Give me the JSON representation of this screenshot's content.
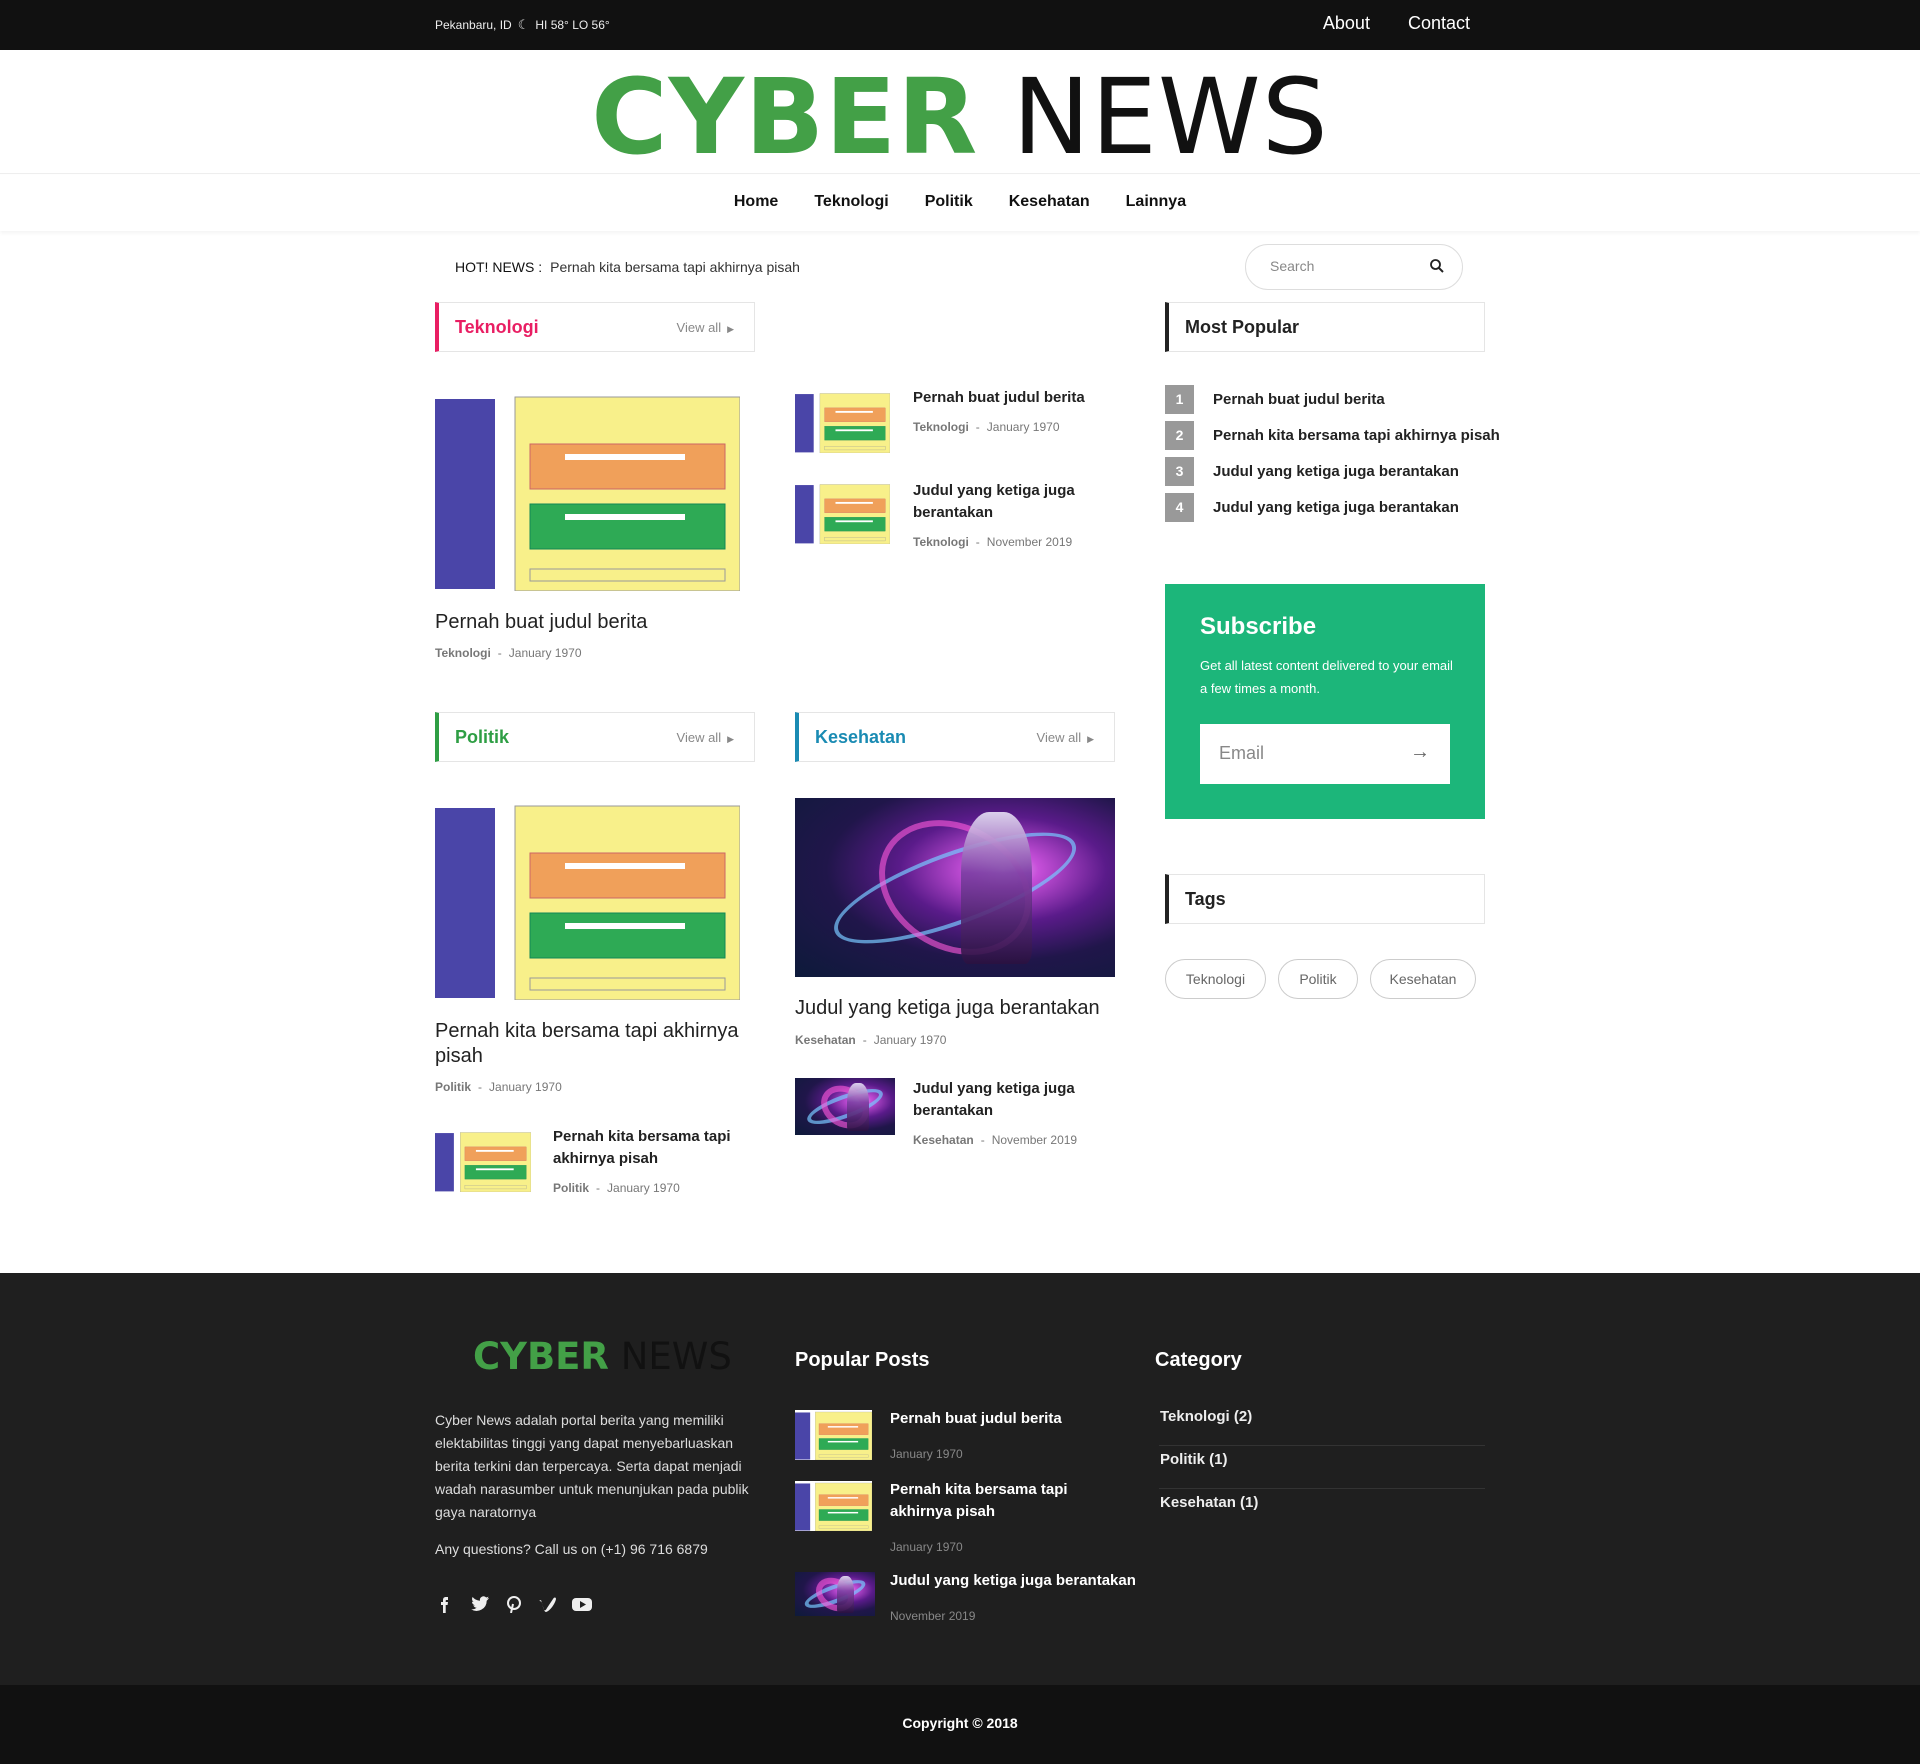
{
  "topbar": {
    "location": "Pekanbaru, ID",
    "weather": "HI 58° LO 56°",
    "links": [
      "About",
      "Contact"
    ]
  },
  "logo": {
    "part1": "CYBER",
    "part2": "NEWS"
  },
  "nav": [
    "Home",
    "Teknologi",
    "Politik",
    "Kesehatan",
    "Lainnya"
  ],
  "hot": {
    "label": "HOT! NEWS :",
    "text": "Pernah kita bersama tapi akhirnya pisah"
  },
  "search": {
    "placeholder": "Search"
  },
  "colors": {
    "teknologi": "#e91e63",
    "politik": "#2e9e44",
    "kesehatan": "#1a8bb3",
    "subscribe": "#1cb67a",
    "logo_green": "#43a047"
  },
  "teknologi": {
    "title": "Teknologi",
    "view_all": "View all",
    "main": {
      "title": "Pernah buat judul berita",
      "cat": "Teknologi",
      "date": "January 1970"
    },
    "side": [
      {
        "title": "Pernah buat judul berita",
        "cat": "Teknologi",
        "date": "January 1970"
      },
      {
        "title": "Judul yang ketiga juga berantakan",
        "cat": "Teknologi",
        "date": "November 2019"
      }
    ]
  },
  "politik": {
    "title": "Politik",
    "view_all": "View all",
    "main": {
      "title": "Pernah kita bersama tapi akhirnya pisah",
      "cat": "Politik",
      "date": "January 1970"
    },
    "side": [
      {
        "title": "Pernah kita bersama tapi akhirnya pisah",
        "cat": "Politik",
        "date": "January 1970"
      }
    ]
  },
  "kesehatan": {
    "title": "Kesehatan",
    "view_all": "View all",
    "main": {
      "title": "Judul yang ketiga juga berantakan",
      "cat": "Kesehatan",
      "date": "January 1970"
    },
    "side": [
      {
        "title": "Judul yang ketiga juga berantakan",
        "cat": "Kesehatan",
        "date": "November 2019"
      }
    ]
  },
  "popular": {
    "title": "Most Popular",
    "items": [
      {
        "num": "1",
        "title": "Pernah buat judul berita"
      },
      {
        "num": "2",
        "title": "Pernah kita bersama tapi akhirnya pisah"
      },
      {
        "num": "3",
        "title": "Judul yang ketiga juga berantakan"
      },
      {
        "num": "4",
        "title": "Judul yang ketiga juga berantakan"
      }
    ]
  },
  "subscribe": {
    "title": "Subscribe",
    "text": "Get all latest content delivered to your email a few times a month.",
    "placeholder": "Email"
  },
  "tags": {
    "title": "Tags",
    "items": [
      "Teknologi",
      "Politik",
      "Kesehatan"
    ]
  },
  "footer": {
    "logo1": "CYBER",
    "logo2": "NEWS",
    "desc": "Cyber News adalah portal berita yang memiliki elektabilitas tinggi yang dapat menyebarluaskan berita terkini dan terpercaya. Serta dapat menjadi wadah narasumber untuk menunjukan pada publik gaya naratornya",
    "call": "Any questions? Call us on (+1) 96 716 6879",
    "popular_title": "Popular Posts",
    "popular": [
      {
        "title": "Pernah buat judul berita",
        "date": "January 1970"
      },
      {
        "title": "Pernah kita bersama tapi akhirnya pisah",
        "date": "January 1970"
      },
      {
        "title": "Judul yang ketiga juga berantakan",
        "date": "November 2019"
      }
    ],
    "category_title": "Category",
    "categories": [
      "Teknologi (2)",
      "Politik (1)",
      "Kesehatan (1)"
    ],
    "social": [
      "facebook-icon",
      "twitter-icon",
      "pinterest-icon",
      "vimeo-icon",
      "youtube-icon"
    ]
  },
  "copyright": "Copyright © 2018"
}
